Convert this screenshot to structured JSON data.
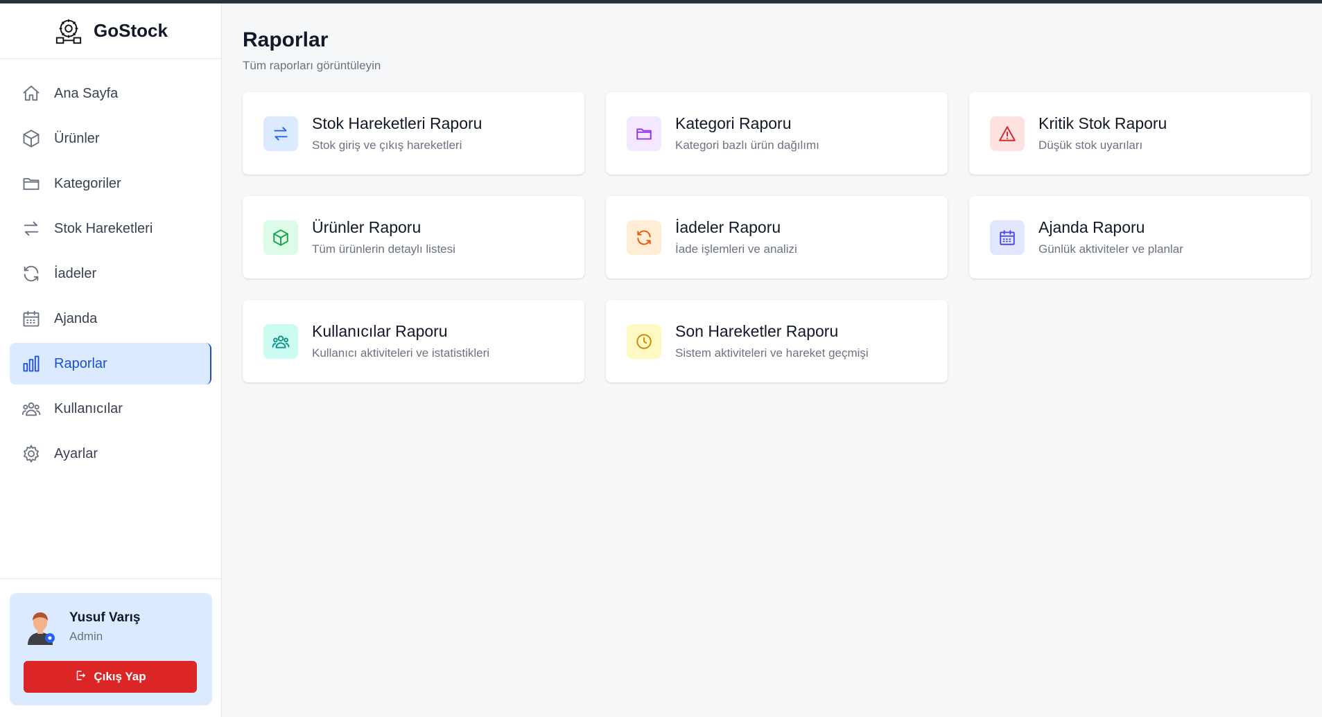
{
  "app": {
    "name": "GoStock"
  },
  "sidebar": {
    "items": [
      {
        "label": "Ana Sayfa",
        "icon": "home-icon",
        "active": false
      },
      {
        "label": "Ürünler",
        "icon": "cube-icon",
        "active": false
      },
      {
        "label": "Kategoriler",
        "icon": "folder-icon",
        "active": false
      },
      {
        "label": "Stok Hareketleri",
        "icon": "arrows-exchange-icon",
        "active": false
      },
      {
        "label": "İadeler",
        "icon": "refresh-icon",
        "active": false
      },
      {
        "label": "Ajanda",
        "icon": "calendar-icon",
        "active": false
      },
      {
        "label": "Raporlar",
        "icon": "bar-chart-icon",
        "active": true
      },
      {
        "label": "Kullanıcılar",
        "icon": "users-icon",
        "active": false
      },
      {
        "label": "Ayarlar",
        "icon": "gear-icon",
        "active": false
      }
    ]
  },
  "user": {
    "name": "Yusuf Varış",
    "role": "Admin",
    "logout_label": "Çıkış Yap"
  },
  "page": {
    "title": "Raporlar",
    "subtitle": "Tüm raporları görüntüleyin"
  },
  "reports": [
    {
      "title": "Stok Hareketleri Raporu",
      "desc": "Stok giriş ve çıkış hareketleri",
      "icon": "arrows-exchange-icon",
      "color": "#2563eb"
    },
    {
      "title": "Kategori Raporu",
      "desc": "Kategori bazlı ürün dağılımı",
      "icon": "folder-icon",
      "color": "#9333ea"
    },
    {
      "title": "Kritik Stok Raporu",
      "desc": "Düşük stok uyarıları",
      "icon": "warning-icon",
      "color": "#dc2626"
    },
    {
      "title": "Ürünler Raporu",
      "desc": "Tüm ürünlerin detaylı listesi",
      "icon": "cube-icon",
      "color": "#16a34a"
    },
    {
      "title": "İadeler Raporu",
      "desc": "İade işlemleri ve analizi",
      "icon": "refresh-icon",
      "color": "#ea580c"
    },
    {
      "title": "Ajanda Raporu",
      "desc": "Günlük aktiviteler ve planlar",
      "icon": "calendar-icon",
      "color": "#4f46e5"
    },
    {
      "title": "Kullanıcılar Raporu",
      "desc": "Kullanıcı aktiviteleri ve istatistikleri",
      "icon": "users-icon",
      "color": "#0d9488"
    },
    {
      "title": "Son Hareketler Raporu",
      "desc": "Sistem aktiviteleri ve hareket geçmişi",
      "icon": "clock-icon",
      "color": "#ca8a04"
    }
  ]
}
